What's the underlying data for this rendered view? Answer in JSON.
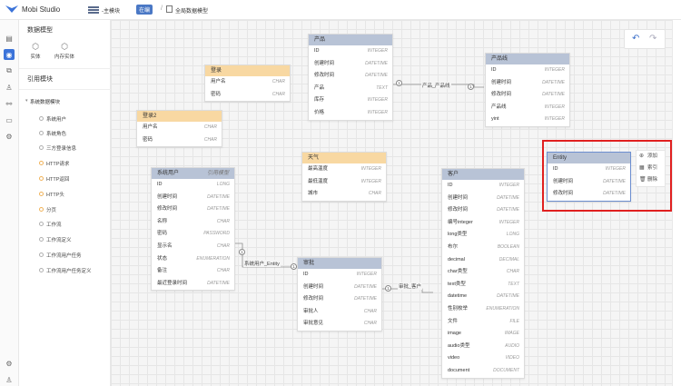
{
  "app": {
    "title": "Mobi Studio"
  },
  "breadcrumb": {
    "module": "-主模块",
    "tag": "在编",
    "page": "全局数据模型"
  },
  "panel": {
    "title": "数据模型",
    "tools": [
      {
        "label": "实体",
        "icon": "entity-icon"
      },
      {
        "label": "内存实体",
        "icon": "memory-entity-icon"
      }
    ],
    "ref_title": "引用模块",
    "tree_root": "系统数据模块",
    "tree_items": [
      "系统用户",
      "系统角色",
      "三方登录信息",
      "HTTP请求",
      "HTTP返回",
      "HTTP头",
      "分页",
      "工作流",
      "工作流定义",
      "工作流用户任务",
      "工作流用户任务定义"
    ]
  },
  "entities": {
    "login": {
      "name": "登录",
      "fields": [
        {
          "n": "用户名",
          "t": "CHAR"
        },
        {
          "n": "密码",
          "t": "CHAR"
        }
      ]
    },
    "login2": {
      "name": "登录2",
      "fields": [
        {
          "n": "用户名",
          "t": "CHAR"
        },
        {
          "n": "密码",
          "t": "CHAR"
        }
      ]
    },
    "product": {
      "name": "产品",
      "fields": [
        {
          "n": "ID",
          "t": "INTEGER"
        },
        {
          "n": "创建时间",
          "t": "DATETIME"
        },
        {
          "n": "修改时间",
          "t": "DATETIME"
        },
        {
          "n": "产品",
          "t": "TEXT"
        },
        {
          "n": "库存",
          "t": "INTEGER"
        },
        {
          "n": "价格",
          "t": "INTEGER"
        }
      ]
    },
    "product_line": {
      "name": "产品线",
      "fields": [
        {
          "n": "ID",
          "t": "INTEGER"
        },
        {
          "n": "创建时间",
          "t": "DATETIME"
        },
        {
          "n": "修改时间",
          "t": "DATETIME"
        },
        {
          "n": "产品线",
          "t": "INTEGER"
        },
        {
          "n": "yint",
          "t": "INTEGER"
        }
      ]
    },
    "weather": {
      "name": "天气",
      "fields": [
        {
          "n": "最高温度",
          "t": "INTEGER"
        },
        {
          "n": "最低温度",
          "t": "INTEGER"
        },
        {
          "n": "城市",
          "t": "CHAR"
        }
      ]
    },
    "sys_user": {
      "name": "系统用户",
      "tag": "引用模型",
      "fields": [
        {
          "n": "ID",
          "t": "LONG"
        },
        {
          "n": "创建时间",
          "t": "DATETIME"
        },
        {
          "n": "修改时间",
          "t": "DATETIME"
        },
        {
          "n": "名称",
          "t": "CHAR"
        },
        {
          "n": "密码",
          "t": "PASSWORD"
        },
        {
          "n": "显示名",
          "t": "CHAR"
        },
        {
          "n": "状态",
          "t": "ENUMERATION"
        },
        {
          "n": "备注",
          "t": "CHAR"
        },
        {
          "n": "最近登录时间",
          "t": "DATETIME"
        }
      ]
    },
    "approval": {
      "name": "审批",
      "fields": [
        {
          "n": "ID",
          "t": "INTEGER"
        },
        {
          "n": "创建时间",
          "t": "DATETIME"
        },
        {
          "n": "修改时间",
          "t": "DATETIME"
        },
        {
          "n": "审批人",
          "t": "CHAR"
        },
        {
          "n": "审批意见",
          "t": "CHAR"
        }
      ]
    },
    "customer": {
      "name": "客户",
      "fields": [
        {
          "n": "ID",
          "t": "INTEGER"
        },
        {
          "n": "创建时间",
          "t": "DATETIME"
        },
        {
          "n": "修改时间",
          "t": "DATETIME"
        },
        {
          "n": "编号integer",
          "t": "INTEGER"
        },
        {
          "n": "long类型",
          "t": "LONG"
        },
        {
          "n": "布尔",
          "t": "BOOLEAN"
        },
        {
          "n": "decimal",
          "t": "DECIMAL"
        },
        {
          "n": "char类型",
          "t": "CHAR"
        },
        {
          "n": "text类型",
          "t": "TEXT"
        },
        {
          "n": "datetime",
          "t": "DATETIME"
        },
        {
          "n": "性别枚举",
          "t": "ENUMERATION"
        },
        {
          "n": "文件",
          "t": "FILE"
        },
        {
          "n": "image",
          "t": "IMAGE"
        },
        {
          "n": "audio类型",
          "t": "AUDIO"
        },
        {
          "n": "video",
          "t": "VIDEO"
        },
        {
          "n": "document",
          "t": "DOCUMENT"
        }
      ]
    },
    "entity": {
      "name": "Entity",
      "fields": [
        {
          "n": "ID",
          "t": "INTEGER"
        },
        {
          "n": "创建时间",
          "t": "DATETIME"
        },
        {
          "n": "修改时间",
          "t": "DATETIME"
        }
      ]
    }
  },
  "links": {
    "product_productline": "产品_产品线",
    "sysuser_entity": "系统用户_Entity",
    "approval_customer": "审批_客户",
    "one": "1"
  },
  "context_menu": [
    {
      "label": "添加",
      "icon": "plus-circle-icon"
    },
    {
      "label": "索引",
      "icon": "index-icon"
    },
    {
      "label": "删除",
      "icon": "trash-icon"
    }
  ],
  "colors": {
    "accent": "#3b73d9",
    "highlight": "#e02020",
    "entity_header": "#b8c3d6",
    "memory_header": "#f8d8a2"
  }
}
